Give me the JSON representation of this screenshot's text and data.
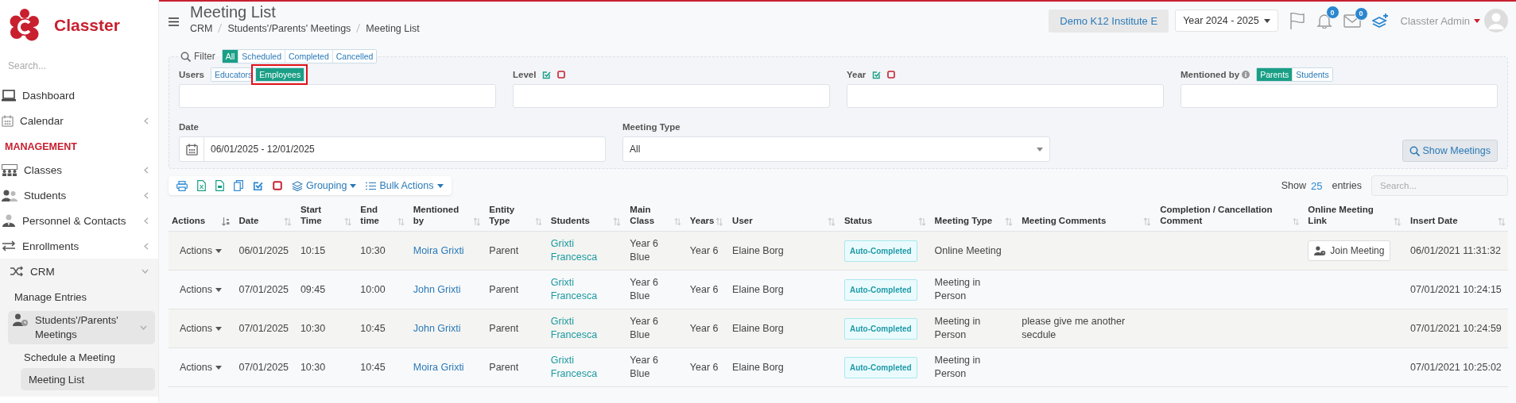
{
  "sidebar": {
    "logo_text": "Classter",
    "search": {
      "placeholder": "Search..."
    },
    "items": [
      {
        "kind": "link",
        "label": "Dashboard",
        "selected": false
      },
      {
        "kind": "group",
        "label": "Calendar",
        "selected": false,
        "expanded": false
      },
      {
        "kind": "heading",
        "label": "MANAGEMENT"
      },
      {
        "kind": "group",
        "label": "Classes",
        "selected": false,
        "expanded": false
      },
      {
        "kind": "group",
        "label": "Students",
        "selected": false,
        "expanded": false
      },
      {
        "kind": "group",
        "label": "Personnel & Contacts",
        "selected": false,
        "expanded": false
      },
      {
        "kind": "group",
        "label": "Enrollments",
        "selected": false,
        "expanded": false
      },
      {
        "kind": "group",
        "label": "CRM",
        "selected": true,
        "expanded": true,
        "children": [
          {
            "kind": "link",
            "label": "Manage Entries",
            "selected": false
          },
          {
            "kind": "group",
            "label": "Students'/Parents' Meetings",
            "selected": true,
            "expanded": true,
            "children": [
              {
                "kind": "link",
                "label": "Schedule a Meeting",
                "selected": false
              },
              {
                "kind": "link",
                "label": "Meeting List",
                "selected": true
              }
            ]
          }
        ]
      }
    ]
  },
  "header": {
    "title": "Meeting List",
    "breadcrumbs": [
      "CRM",
      "Students'/Parents' Meetings",
      "Meeting List"
    ],
    "institute": "Demo K12 Institute E",
    "year": "Year 2024 - 2025",
    "notifications": "0",
    "messages": "0",
    "user": "Classter Admin"
  },
  "filter": {
    "label": "Filter",
    "status_tabs": [
      {
        "label": "All",
        "selected": true
      },
      {
        "label": "Scheduled",
        "selected": false
      },
      {
        "label": "Completed",
        "selected": false
      },
      {
        "label": "Cancelled",
        "selected": false
      }
    ],
    "users": {
      "label": "Users",
      "options": [
        {
          "label": "Educators",
          "selected": false,
          "highlighted": false
        },
        {
          "label": "Employees",
          "selected": true,
          "highlighted": true
        }
      ]
    },
    "level": {
      "label": "Level"
    },
    "year": {
      "label": "Year"
    },
    "mentioned_by": {
      "label": "Mentioned by",
      "options": [
        {
          "label": "Parents",
          "selected": true
        },
        {
          "label": "Students",
          "selected": false
        }
      ]
    },
    "date": {
      "label": "Date",
      "value": "06/01/2025 - 12/01/2025"
    },
    "meeting_type": {
      "label": "Meeting Type",
      "value": "All"
    },
    "show_button": "Show Meetings"
  },
  "toolbar": {
    "grouping": "Grouping",
    "bulk_actions": "Bulk Actions",
    "show_label": "Show",
    "page_size": "25",
    "entries_label": "entries",
    "search": {
      "placeholder": "Search..."
    }
  },
  "table": {
    "columns": [
      {
        "label": "Actions",
        "sorted": true
      },
      {
        "label": "Date",
        "sorted": false
      },
      {
        "label": "Start Time",
        "sorted": false
      },
      {
        "label": "End time",
        "sorted": false
      },
      {
        "label": "Mentioned by",
        "sorted": false
      },
      {
        "label": "Entity Type",
        "sorted": false
      },
      {
        "label": "Students",
        "sorted": false
      },
      {
        "label": "Main Class",
        "sorted": false
      },
      {
        "label": "Years",
        "sorted": false
      },
      {
        "label": "User",
        "sorted": false
      },
      {
        "label": "Status",
        "sorted": false
      },
      {
        "label": "Meeting Type",
        "sorted": false
      },
      {
        "label": "Meeting Comments",
        "sorted": false
      },
      {
        "label": "Completion / Cancellation Comment",
        "sorted": false
      },
      {
        "label": "Online Meeting Link",
        "sorted": false
      },
      {
        "label": "Insert Date",
        "sorted": false
      }
    ],
    "rows": [
      {
        "actions": "Actions",
        "date": "06/01/2025",
        "start_time": "10:15",
        "end_time": "10:30",
        "mentioned_by": "Moira Grixti",
        "entity_type": "Parent",
        "students": "Grixti Francesca",
        "main_class": "Year 6 Blue",
        "years": "Year 6",
        "user": "Elaine Borg",
        "status": "Auto-Completed",
        "meeting_type": "Online Meeting",
        "online_meeting_link": "Join Meeting",
        "insert_date": "06/01/2021 11:31:32"
      },
      {
        "actions": "Actions",
        "date": "07/01/2025",
        "start_time": "09:45",
        "end_time": "10:00",
        "mentioned_by": "John Grixti",
        "entity_type": "Parent",
        "students": "Grixti Francesca",
        "main_class": "Year 6 Blue",
        "years": "Year 6",
        "user": "Elaine Borg",
        "status": "Auto-Completed",
        "meeting_type": "Meeting in Person",
        "insert_date": "07/01/2021 10:24:15"
      },
      {
        "actions": "Actions",
        "date": "07/01/2025",
        "start_time": "10:30",
        "end_time": "10:45",
        "mentioned_by": "John Grixti",
        "entity_type": "Parent",
        "students": "Grixti Francesca",
        "main_class": "Year 6 Blue",
        "years": "Year 6",
        "user": "Elaine Borg",
        "status": "Auto-Completed",
        "meeting_type": "Meeting in Person",
        "meeting_comments": "please give me another secdule",
        "insert_date": "07/01/2021 10:24:59"
      },
      {
        "actions": "Actions",
        "date": "07/01/2025",
        "start_time": "10:30",
        "end_time": "10:45",
        "mentioned_by": "Moira Grixti",
        "entity_type": "Parent",
        "students": "Grixti Francesca",
        "main_class": "Year 6 Blue",
        "years": "Year 6",
        "user": "Elaine Borg",
        "status": "Auto-Completed",
        "meeting_type": "Meeting in Person",
        "insert_date": "07/01/2021 10:25:02"
      }
    ]
  }
}
